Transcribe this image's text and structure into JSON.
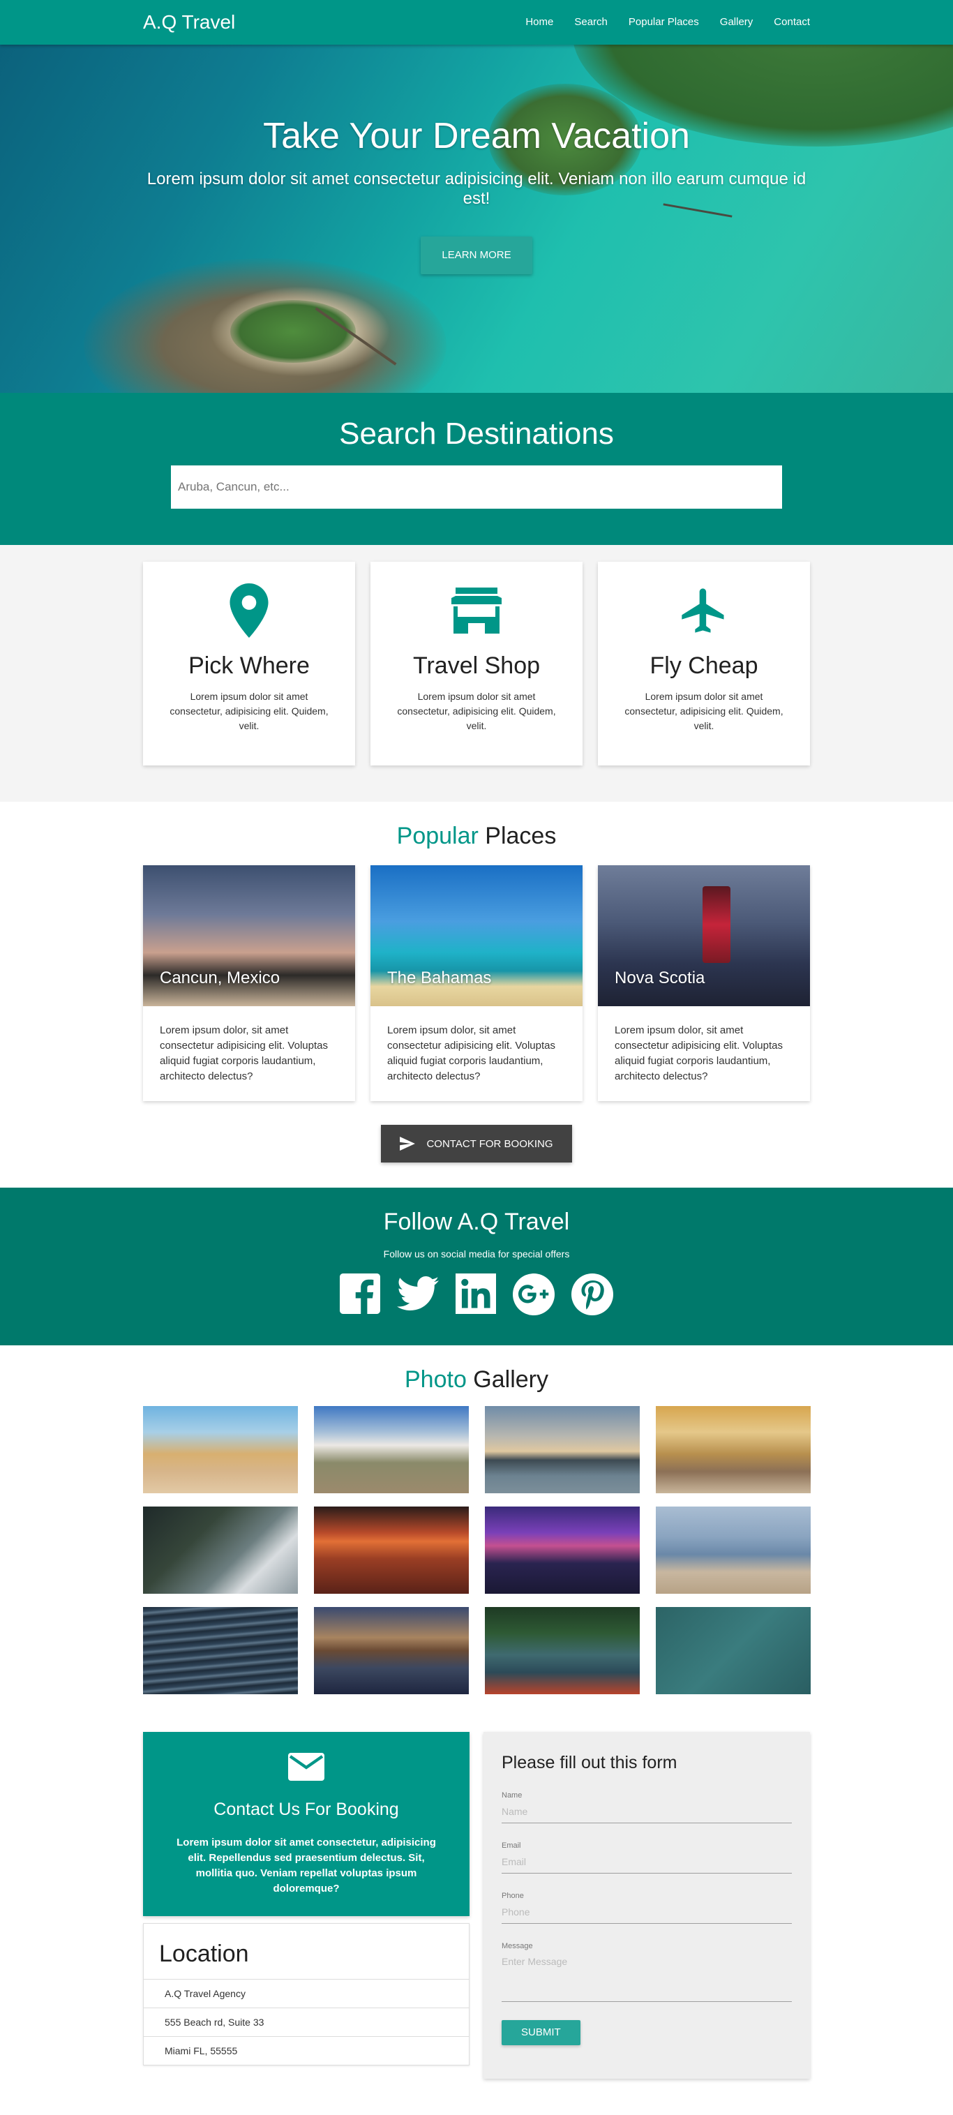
{
  "nav": {
    "brand": "A.Q Travel",
    "links": [
      "Home",
      "Search",
      "Popular Places",
      "Gallery",
      "Contact"
    ]
  },
  "hero": {
    "title": "Take Your Dream Vacation",
    "subtitle": "Lorem ipsum dolor sit amet consectetur adipisicing elit. Veniam non illo earum cumque id est!",
    "button": "LEARN MORE"
  },
  "search": {
    "title": "Search Destinations",
    "placeholder": "Aruba, Cancun, etc..."
  },
  "features": [
    {
      "icon": "map-marker-icon",
      "title": "Pick Where",
      "text": "Lorem ipsum dolor sit amet consectetur, adipisicing elit. Quidem, velit."
    },
    {
      "icon": "store-icon",
      "title": "Travel Shop",
      "text": "Lorem ipsum dolor sit amet consectetur, adipisicing elit. Quidem, velit."
    },
    {
      "icon": "airplane-icon",
      "title": "Fly Cheap",
      "text": "Lorem ipsum dolor sit amet consectetur, adipisicing elit. Quidem, velit."
    }
  ],
  "popular": {
    "title_accent": "Popular",
    "title_rest": " Places",
    "places": [
      {
        "name": "Cancun, Mexico",
        "text": "Lorem ipsum dolor, sit amet consectetur adipisicing elit. Voluptas aliquid fugiat corporis laudantium, architecto delectus?"
      },
      {
        "name": "The Bahamas",
        "text": "Lorem ipsum dolor, sit amet consectetur adipisicing elit. Voluptas aliquid fugiat corporis laudantium, architecto delectus?"
      },
      {
        "name": "Nova Scotia",
        "text": "Lorem ipsum dolor, sit amet consectetur adipisicing elit. Voluptas aliquid fugiat corporis laudantium, architecto delectus?"
      }
    ],
    "button": "CONTACT FOR BOOKING"
  },
  "follow": {
    "title": "Follow A.Q Travel",
    "subtitle": "Follow us on social media for special offers",
    "icons": [
      "facebook-icon",
      "twitter-icon",
      "linkedin-icon",
      "google-plus-icon",
      "pinterest-icon"
    ]
  },
  "gallery": {
    "title_accent": "Photo",
    "title_rest": " Gallery"
  },
  "contact": {
    "title": "Contact Us For Booking",
    "text": "Lorem ipsum dolor sit amet consectetur, adipisicing elit. Repellendus sed praesentium delectus. Sit, mollitia quo. Veniam repellat voluptas ipsum doloremque?",
    "location_title": "Location",
    "location_lines": [
      "A.Q Travel Agency",
      "555 Beach rd, Suite 33",
      "Miami FL, 55555"
    ]
  },
  "form": {
    "title": "Please fill out this form",
    "fields": [
      {
        "label": "Name",
        "placeholder": "Name"
      },
      {
        "label": "Email",
        "placeholder": "Email"
      },
      {
        "label": "Phone",
        "placeholder": "Phone"
      },
      {
        "label": "Message",
        "placeholder": "Enter Message"
      }
    ],
    "submit": "SUBMIT"
  },
  "colors": {
    "primary": "#009688",
    "primary_dark": "#00796b",
    "accent": "#26a69a"
  }
}
